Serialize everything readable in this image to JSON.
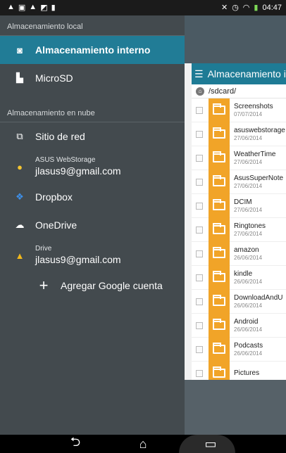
{
  "status_bar": {
    "time": "04:47",
    "left_icons": [
      "warning-icon",
      "image-icon",
      "warning-icon",
      "sd-icon",
      "file-icon"
    ],
    "right_icons": [
      "mute-icon",
      "alarm-icon",
      "wifi-icon",
      "battery-icon"
    ]
  },
  "drawer": {
    "local_title": "Almacenamiento local",
    "local_items": [
      {
        "label": "Almacenamiento interno",
        "icon": "storage-icon",
        "active": true
      },
      {
        "label": "MicroSD",
        "icon": "sdcard-icon",
        "active": false
      }
    ],
    "cloud_title": "Almacenamiento en nube",
    "cloud_items": [
      {
        "label": "Sitio de red",
        "icon": "network-icon"
      },
      {
        "small": "ASUS WebStorage",
        "big": "jlasus9@gmail.com",
        "icon": "webstorage-icon"
      },
      {
        "label": "Dropbox",
        "icon": "dropbox-icon"
      },
      {
        "label": "OneDrive",
        "icon": "onedrive-icon"
      },
      {
        "small": "Drive",
        "big": "jlasus9@gmail.com",
        "icon": "drive-icon"
      }
    ],
    "add_account": "Agregar Google cuenta"
  },
  "file_panel": {
    "title": "Almacenamiento in",
    "path": "/sdcard/",
    "files": [
      {
        "name": "Screenshots",
        "date": "07/07/2014"
      },
      {
        "name": "asuswebstorage",
        "date": "27/06/2014"
      },
      {
        "name": "WeatherTime",
        "date": "27/06/2014"
      },
      {
        "name": "AsusSuperNote",
        "date": "27/06/2014"
      },
      {
        "name": "DCIM",
        "date": "27/06/2014"
      },
      {
        "name": "Ringtones",
        "date": "27/06/2014"
      },
      {
        "name": "amazon",
        "date": "26/06/2014"
      },
      {
        "name": "kindle",
        "date": "26/06/2014"
      },
      {
        "name": "DownloadAndU",
        "date": "26/06/2014"
      },
      {
        "name": "Android",
        "date": "26/06/2014"
      },
      {
        "name": "Podcasts",
        "date": "26/06/2014"
      },
      {
        "name": "Pictures",
        "date": ""
      }
    ]
  },
  "nav_bar": {
    "back": "⮌",
    "home": "⌂",
    "recent": "▭"
  }
}
